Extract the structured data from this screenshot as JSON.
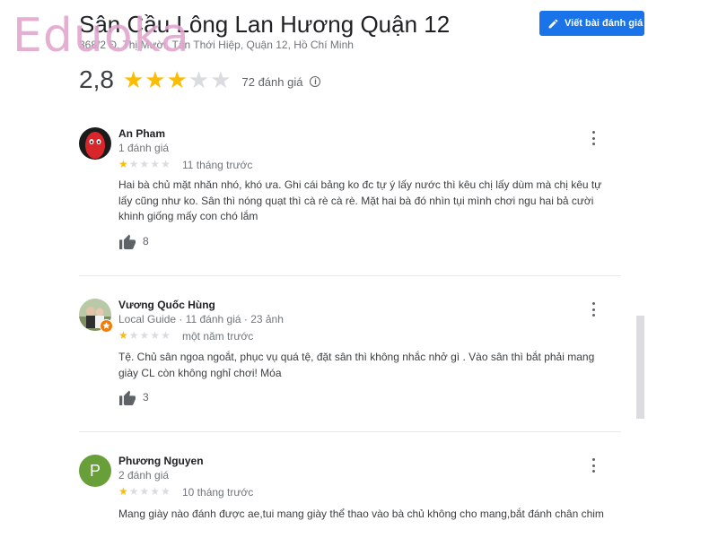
{
  "watermark": "Eduoka",
  "place": {
    "title": "Sân Cầu Lông Lan Hương Quận 12",
    "address": "368/2 Đ. Thị Mười, Tân Thới Hiệp, Quận 12, Hồ Chí Minh",
    "write_review_label": "Viết bài đánh giá",
    "rating": "2,8",
    "rating_stars": 3,
    "review_count": "72 đánh giá"
  },
  "colors": {
    "accent": "#1a73e8",
    "star_on": "#fbbc04",
    "star_off": "#dadce0"
  },
  "reviews": [
    {
      "name": "An Pham",
      "meta": "1 đánh giá",
      "stars": 1,
      "time": "11 tháng trước",
      "text": "Hai bà chủ mặt nhăn nhó, khó ưa. Ghi cái bảng ko đc tự ý lấy nước thì kêu chị lấy dùm mà chị kêu tự lấy cũng như ko. Sân thì nóng quạt thì cà rè cà rè. Mặt hai bà đó nhìn tụi mình chơi ngu hai bả cười khinh giống mấy con chó lắm",
      "likes": "8",
      "avatar_letter": ""
    },
    {
      "name": "Vương Quốc Hùng",
      "meta": "Local Guide · 11 đánh giá · 23 ảnh",
      "stars": 1,
      "time": "một năm trước",
      "text": "Tệ. Chủ sân ngoa ngoắt, phục vụ quá tệ, đặt sân thì không nhắc nhở gì . Vào sân thì bắt phải mang giày CL còn không nghỉ chơi!  Móa",
      "likes": "3",
      "avatar_letter": ""
    },
    {
      "name": "Phương Nguyen",
      "meta": "2 đánh giá",
      "stars": 1,
      "time": "10 tháng trước",
      "text": "Mang giày nào đánh được ae,tui mang giày thể thao vào bà chủ không cho mang,bắt đánh chân chim",
      "likes": "",
      "avatar_letter": "P"
    }
  ]
}
